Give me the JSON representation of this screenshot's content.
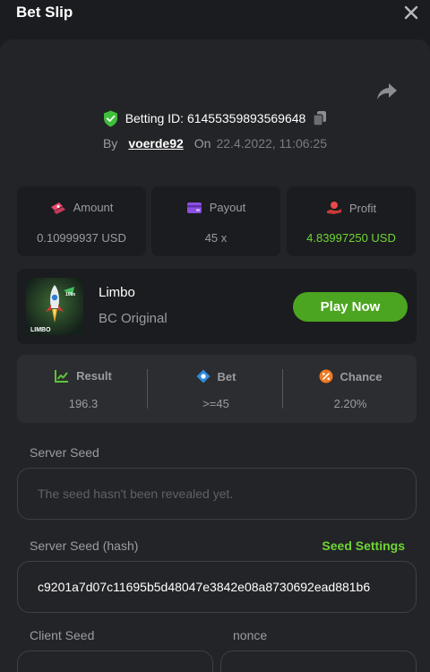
{
  "header": {
    "title": "Bet Slip"
  },
  "bet": {
    "id_label": "Betting ID: 61455359893569648",
    "by_label": "By",
    "username": "voerde92",
    "on_label": "On",
    "datetime": "22.4.2022, 11:06:25"
  },
  "stats": {
    "amount": {
      "label": "Amount",
      "value": "0.10999937 USD"
    },
    "payout": {
      "label": "Payout",
      "value": "45 x"
    },
    "profit": {
      "label": "Profit",
      "value": "4.83997250 USD"
    }
  },
  "game": {
    "name": "Limbo",
    "subtitle": "BC Original",
    "play_label": "Play Now",
    "thumb_text": "LIMBO",
    "thumb_badge": "100x"
  },
  "result": {
    "result": {
      "label": "Result",
      "value": "196.3"
    },
    "bet": {
      "label": "Bet",
      "value": ">=45"
    },
    "chance": {
      "label": "Chance",
      "value": "2.20%"
    }
  },
  "seeds": {
    "server_seed_label": "Server Seed",
    "server_seed_placeholder": "The seed hasn't been revealed yet.",
    "server_hash_label": "Server Seed (hash)",
    "seed_settings_label": "Seed Settings",
    "server_hash_value": "c9201a7d07c11695b5d48047e3842e08a8730692ead881b6",
    "client_seed_label": "Client Seed",
    "nonce_label": "nonce"
  },
  "colors": {
    "accent_green": "#6fd534",
    "button_green": "#4ca520",
    "panel_bg": "#232427",
    "page_bg": "#1b1c1f"
  },
  "icons": [
    "close-icon",
    "share-icon",
    "shield-check-icon",
    "copy-icon",
    "amount-icon",
    "payout-icon",
    "profit-icon",
    "result-icon",
    "bet-icon",
    "chance-icon"
  ]
}
